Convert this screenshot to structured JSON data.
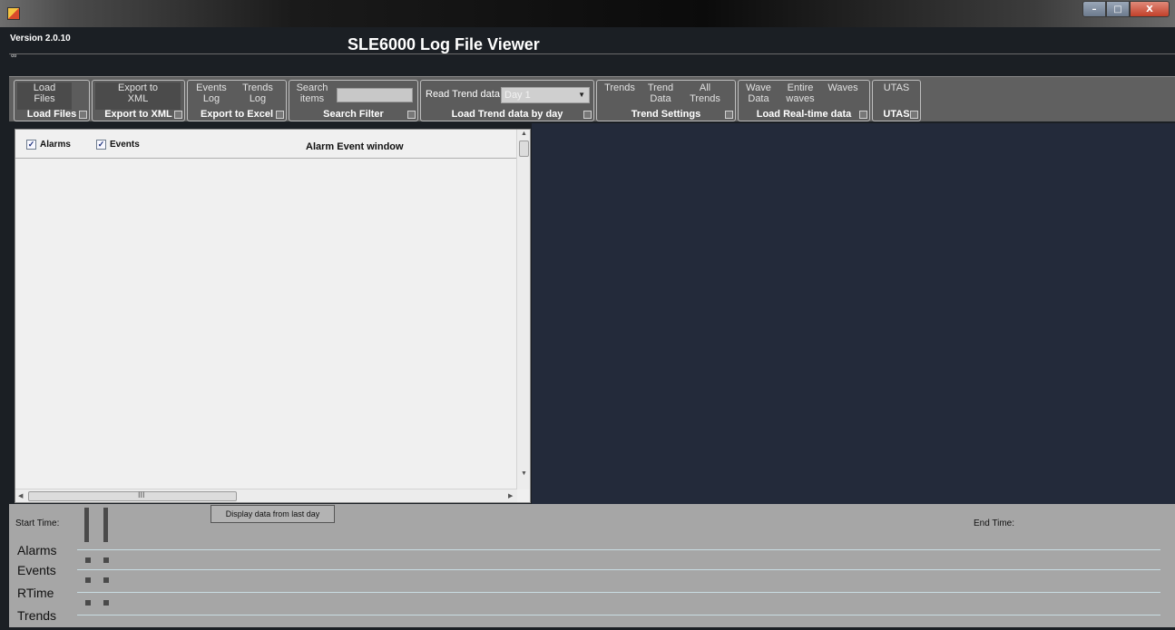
{
  "window": {
    "minimize_glyph": "–",
    "maximize_glyph": "□",
    "close_glyph": "X"
  },
  "header": {
    "version": "Version 2.0.10",
    "title": "SLE6000 Log File Viewer",
    "small_glyph": "∞"
  },
  "ribbon": {
    "load_files": {
      "button": "Load Files",
      "label": "Load Files"
    },
    "export_xml": {
      "button": "Export to XML",
      "label": "Export to XML"
    },
    "export_excel": {
      "events_button": "Events Log",
      "trends_button": "Trends Log",
      "label": "Export to Excel"
    },
    "search_filter": {
      "button": "Search items",
      "input_value": "",
      "label": "Search Filter"
    },
    "load_trend": {
      "caption": "Read Trend data",
      "select_value": "Day 1",
      "label": "Load Trend data by day"
    },
    "trend_settings": {
      "trends_button": "Trends",
      "trend_data_button": "Trend Data",
      "all_trends_button": "All Trends",
      "label": "Trend Settings"
    },
    "realtime": {
      "wave_data_button": "Wave Data",
      "entire_waves_button": "Entire waves",
      "waves_button": "Waves",
      "label": "Load Real-time data"
    },
    "utas": {
      "button": "UTAS",
      "label": "UTAS"
    }
  },
  "alarm_panel": {
    "alarms_checkbox": {
      "label": "Alarms",
      "checked": true
    },
    "events_checkbox": {
      "label": "Events",
      "checked": true
    },
    "title": "Alarm Event window",
    "hscroll_grip": "III"
  },
  "timeline": {
    "start_label": "Start Time:",
    "end_label": "End Time:",
    "display_button": "Display data from last day",
    "rows": [
      "Alarms",
      "Events",
      "RTime",
      "Trends"
    ]
  }
}
